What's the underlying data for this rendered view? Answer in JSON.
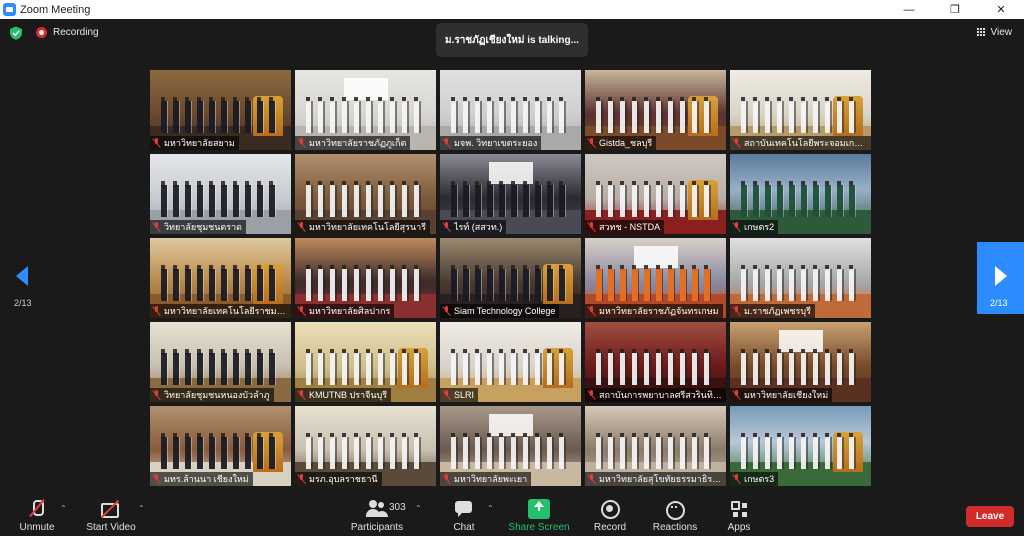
{
  "window": {
    "title": "Zoom Meeting"
  },
  "topbar": {
    "recording_label": "Recording",
    "talking_text": "ม.ราชภัฏเชียงใหม่ is talking...",
    "view_label": "View"
  },
  "pagination": {
    "left_page": "2/13",
    "right_page": "2/13"
  },
  "gallery": {
    "tiles": [
      {
        "name": "มหาวิทยาลัยสยาม",
        "scene": "indoor-ceremony",
        "colors": [
          "#6b4a2e",
          "#3a2a20",
          "#8a6a40"
        ]
      },
      {
        "name": "มหาวิทยาลัยราชภัฏภูเก็ต",
        "scene": "indoor-ceremony",
        "colors": [
          "#d8d6d2",
          "#b9b5ae",
          "#e8e6e2"
        ]
      },
      {
        "name": "มจพ. วิทยาเขตระยอง",
        "scene": "indoor-ceremony",
        "colors": [
          "#cfcfcf",
          "#a9a9a9",
          "#e0e0e0"
        ]
      },
      {
        "name": "Gistda_ชลบุรี",
        "scene": "indoor-ceremony",
        "colors": [
          "#5a3030",
          "#7a4a2a",
          "#c9b89a"
        ]
      },
      {
        "name": "สถาบันเทคโนโลยีพระจอมเกล้า...",
        "scene": "indoor-ceremony",
        "colors": [
          "#d9d4c8",
          "#b89a6a",
          "#f0ece4"
        ]
      },
      {
        "name": "วิทยาลัยชุมชนตราด",
        "scene": "indoor-ceremony",
        "colors": [
          "#c8ccd0",
          "#9aa0a6",
          "#e4e6e8"
        ]
      },
      {
        "name": "มหาวิทยาลัยเทคโนโลยีสุรนารี",
        "scene": "indoor-ceremony",
        "colors": [
          "#7a5a3a",
          "#5a4030",
          "#b49070"
        ]
      },
      {
        "name": "ไรท์ (สสวท.)",
        "scene": "indoor-ceremony",
        "colors": [
          "#2a2a30",
          "#4a4a55",
          "#8a8a95"
        ]
      },
      {
        "name": "สวทช - NSTDA",
        "scene": "indoor-ceremony",
        "colors": [
          "#b8b0a8",
          "#8a2020",
          "#d0c8c0"
        ]
      },
      {
        "name": "เกษตร2",
        "scene": "outdoor",
        "colors": [
          "#5a7a9a",
          "#2f5a3a",
          "#9ab0c8"
        ]
      },
      {
        "name": "มหาวิทยาลัยเทคโนโลยีราชมงคล...",
        "scene": "indoor-ceremony",
        "colors": [
          "#b88a4a",
          "#8a5a2a",
          "#e0c8a0"
        ]
      },
      {
        "name": "มหาวิทยาลัยศิลปากร",
        "scene": "indoor-ceremony",
        "colors": [
          "#3a2a2a",
          "#8a3030",
          "#c08a5a"
        ]
      },
      {
        "name": "Siam Technology College",
        "scene": "indoor-ceremony",
        "colors": [
          "#4a3a30",
          "#2a2020",
          "#9a8a70"
        ]
      },
      {
        "name": "มหาวิทยาลัยราชภัฏจันทรเกษม",
        "scene": "indoor-ceremony",
        "colors": [
          "#8a8aa0",
          "#b04a2a",
          "#d8d0c8"
        ]
      },
      {
        "name": "ม.ราชภัฏเพชรบุรี",
        "scene": "indoor-ceremony",
        "colors": [
          "#a8a8a8",
          "#c06a3a",
          "#e0e0e0"
        ]
      },
      {
        "name": "วิทยาลัยชุมชนหนองบัวลำภู",
        "scene": "indoor-ceremony",
        "colors": [
          "#c8c0b0",
          "#8a6a40",
          "#e8e0d0"
        ]
      },
      {
        "name": "KMUTNB ปราจีนบุรี",
        "scene": "indoor-ceremony",
        "colors": [
          "#d0c090",
          "#a08040",
          "#ece0b8"
        ]
      },
      {
        "name": "SLRI",
        "scene": "indoor-ceremony",
        "colors": [
          "#d8d4cc",
          "#c8a060",
          "#f0ece4"
        ]
      },
      {
        "name": "สถาบันการพยาบาลศรีสวรินทิรา...",
        "scene": "indoor-ceremony",
        "colors": [
          "#6a1a1a",
          "#3a1010",
          "#a05040"
        ]
      },
      {
        "name": "มหาวิทยาลัยเชียงใหม่",
        "scene": "indoor-ceremony",
        "colors": [
          "#7a4a2a",
          "#5a3020",
          "#c8a070"
        ]
      },
      {
        "name": "มทร.ล้านนา เชียงใหม่",
        "scene": "indoor-ceremony",
        "colors": [
          "#8a5a3a",
          "#d8d0c0",
          "#b09070"
        ]
      },
      {
        "name": "มรภ.อุบลราชธานี",
        "scene": "indoor-ceremony",
        "colors": [
          "#c8c0b0",
          "#5a4a3a",
          "#e8e0d0"
        ]
      },
      {
        "name": "มหาวิทยาลัยพะเยา",
        "scene": "indoor-ceremony",
        "colors": [
          "#6a5a50",
          "#c8b8a0",
          "#a89888"
        ]
      },
      {
        "name": "มหาวิทยาลัยสุโขทัยธรรมาธิราช",
        "scene": "indoor-ceremony",
        "colors": [
          "#8a7a6a",
          "#c0b0a0",
          "#d8c8b8"
        ]
      },
      {
        "name": "เกษตร3",
        "scene": "outdoor",
        "colors": [
          "#7a9ab8",
          "#3a6a3a",
          "#b8c8d8"
        ]
      }
    ]
  },
  "toolbar": {
    "unmute_label": "Unmute",
    "start_video_label": "Start Video",
    "participants_label": "Participants",
    "participants_count": "303",
    "chat_label": "Chat",
    "share_screen_label": "Share Screen",
    "record_label": "Record",
    "reactions_label": "Reactions",
    "apps_label": "Apps",
    "leave_label": "Leave",
    "share_color": "#23c16b",
    "leave_color": "#d12b2b"
  }
}
